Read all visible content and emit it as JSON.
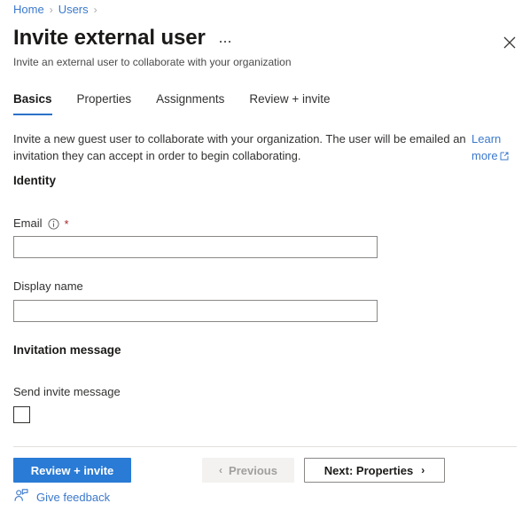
{
  "breadcrumb": {
    "items": [
      {
        "label": "Home"
      },
      {
        "label": "Users"
      }
    ],
    "separator": "›"
  },
  "header": {
    "title": "Invite external user",
    "subtitle": "Invite an external user to collaborate with your organization",
    "more_menu_icon": "ellipsis-icon",
    "close_icon": "close-icon"
  },
  "tabs": [
    {
      "label": "Basics",
      "active": true
    },
    {
      "label": "Properties",
      "active": false
    },
    {
      "label": "Assignments",
      "active": false
    },
    {
      "label": "Review + invite",
      "active": false
    }
  ],
  "intro": {
    "text": "Invite a new guest user to collaborate with your organization. The user will be emailed an invitation they can accept in order to begin collaborating.",
    "learn_more_label": "Learn more",
    "external_link_icon": "external-link-icon"
  },
  "identity": {
    "heading": "Identity",
    "email": {
      "label": "Email",
      "required_marker": "*",
      "info_icon": "info-icon",
      "value": "",
      "placeholder": ""
    },
    "display_name": {
      "label": "Display name",
      "value": "",
      "placeholder": ""
    }
  },
  "invitation": {
    "heading": "Invitation message",
    "send_invite": {
      "label": "Send invite message",
      "checked": false
    }
  },
  "footer": {
    "review_invite_label": "Review + invite",
    "previous_label": "Previous",
    "previous_chevron": "‹",
    "previous_disabled": true,
    "next_label": "Next: Properties",
    "next_chevron": "›",
    "give_feedback_label": "Give feedback",
    "give_feedback_icon": "feedback-person-icon"
  },
  "colors": {
    "accent": "#2a7bd5",
    "link": "#3b79cc",
    "required": "#a4262c",
    "tab_underline": "#2a72c9",
    "input_border": "#8a8886",
    "divider": "#e1dfdd",
    "disabled_bg": "#f3f2f1",
    "disabled_text": "#a19f9d"
  }
}
